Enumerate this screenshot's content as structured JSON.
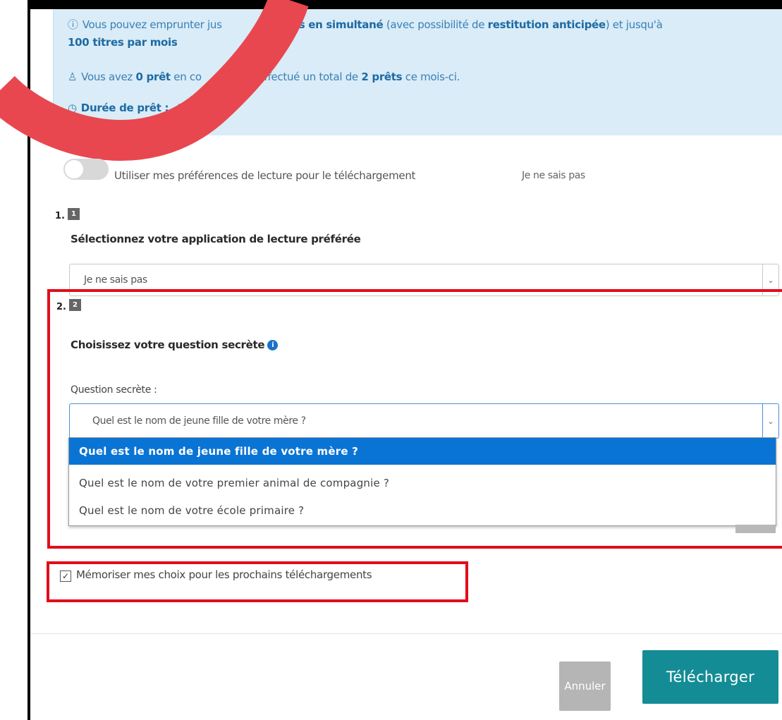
{
  "info": {
    "line1_a": "Vous pouvez emprunter jus",
    "line1_b": "2 titres en simultané",
    "line1_c": "(avec possibilité de",
    "line1_d": "restitution anticipée",
    "line1_e": ") et jusqu'à",
    "line2": "100 titres par mois",
    "line3_a": "Vous avez",
    "line3_b": "0 prêt",
    "line3_c": "en co",
    "line3_d": "et avez effectué un total de",
    "line3_e": "2 prêts",
    "line3_f": "ce mois-ci.",
    "line4_a": "Durée de prêt :",
    "line4_b": "2",
    "line4_c": "rs"
  },
  "preferences": {
    "toggle_label": "Utiliser mes préférences de lecture pour le téléchargement",
    "toggle_value": "Je ne sais pas",
    "toggle_on": false
  },
  "step1": {
    "number": "1.",
    "badge": "1",
    "title": "Sélectionnez votre application de lecture préférée",
    "selected": "Je ne sais pas"
  },
  "step2": {
    "number": "2.",
    "badge": "2",
    "title": "Choisissez votre question secrète",
    "info_icon": "i",
    "field_label": "Question secrète :",
    "selected": "Quel est le nom de jeune fille de votre mère ?",
    "options": [
      "Quel est le nom de jeune fille de votre mère ?",
      "Quel est le nom de votre premier animal de compagnie ?",
      "Quel est le nom de votre école primaire ?"
    ],
    "highlighted_index": 0
  },
  "remember": {
    "label": "Mémoriser mes choix pour les prochains téléchargements",
    "checked": true
  },
  "buttons": {
    "cancel": "Annuler",
    "download": "Télécharger"
  },
  "colors": {
    "info_bg": "#d9ecf7",
    "accent": "#148c95",
    "highlight": "#0a74d4",
    "annotation_red": "#e20d1a"
  }
}
